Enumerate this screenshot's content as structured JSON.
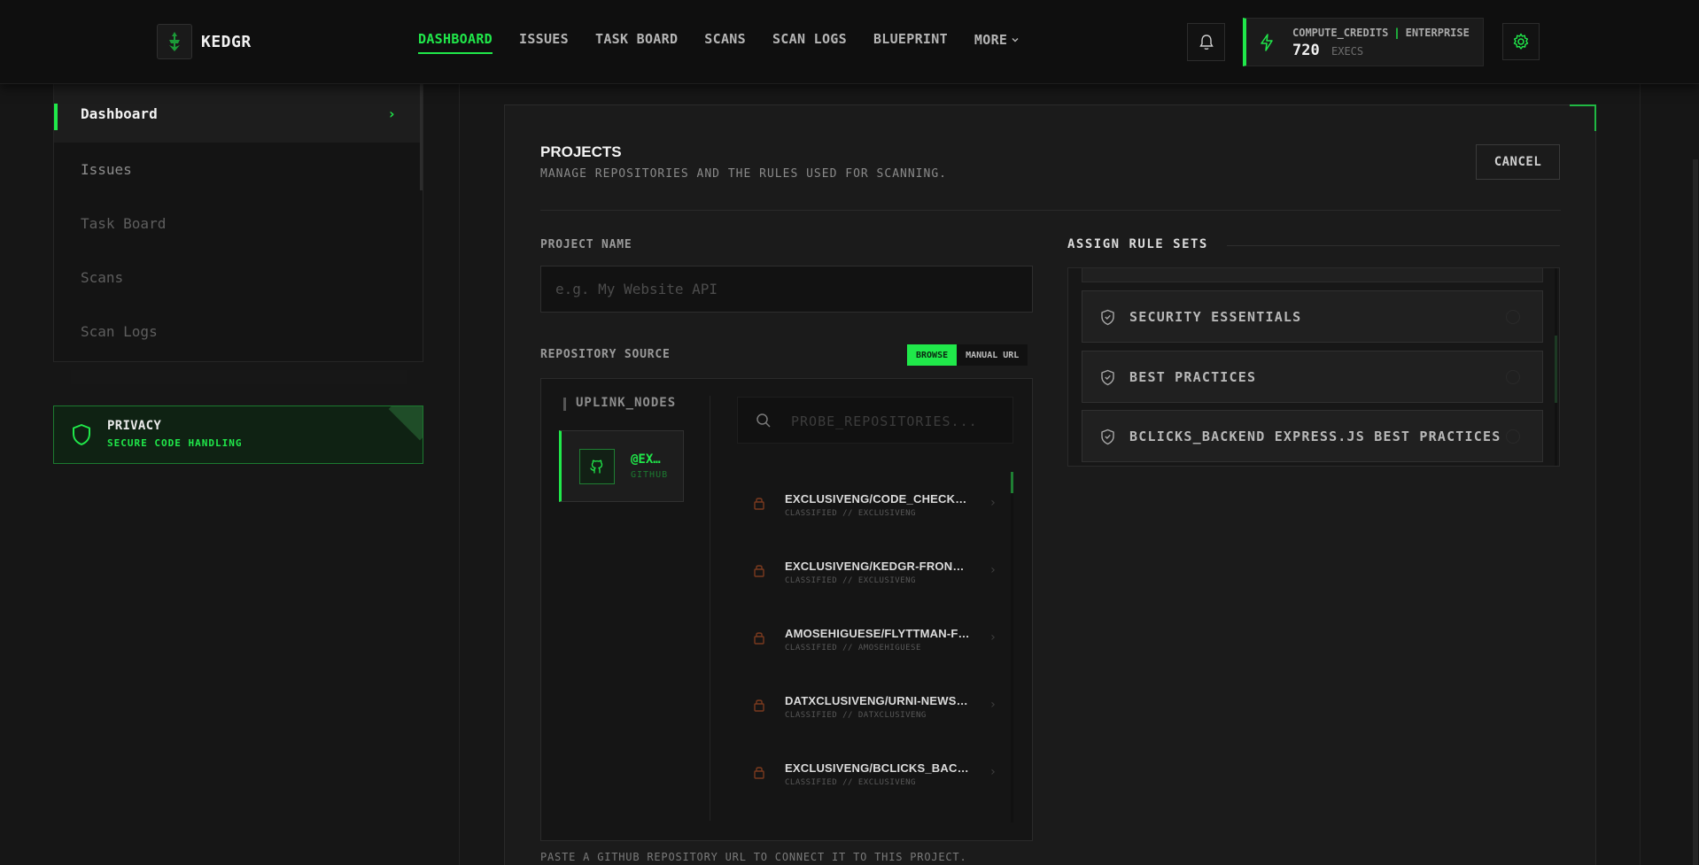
{
  "app": {
    "name": "KEDGR"
  },
  "nav": {
    "items": [
      "DASHBOARD",
      "ISSUES",
      "TASK BOARD",
      "SCANS",
      "SCAN LOGS",
      "BLUEPRINT"
    ],
    "more": "MORE",
    "active": "DASHBOARD"
  },
  "credits": {
    "label": "COMPUTE_CREDITS",
    "tier": "ENTERPRISE",
    "value": "720",
    "unit": "EXECS"
  },
  "sidebar": {
    "items": [
      {
        "label": "Dashboard"
      },
      {
        "label": "Issues"
      },
      {
        "label": "Task Board"
      },
      {
        "label": "Scans"
      },
      {
        "label": "Scan Logs"
      }
    ]
  },
  "privacy": {
    "title": "PRIVACY",
    "subtitle": "SECURE CODE HANDLING"
  },
  "projects": {
    "title": "PROJECTS",
    "subtitle": "MANAGE REPOSITORIES AND THE RULES USED FOR SCANNING.",
    "cancel": "CANCEL",
    "name_label": "PROJECT NAME",
    "name_placeholder": "e.g. My Website API",
    "repo_source_label": "REPOSITORY SOURCE",
    "toggle": {
      "browse": "BROWSE",
      "manual": "MANUAL URL",
      "selected": "BROWSE"
    },
    "uplink_title": "UPLINK_NODES",
    "node": {
      "name": "@EX…",
      "provider": "GITHUB"
    },
    "search_placeholder": "PROBE_REPOSITORIES...",
    "repos": [
      {
        "name": "EXCLUSIVENG/CODE_CHECKER",
        "meta": "CLASSIFIED // EXCLUSIVENG"
      },
      {
        "name": "EXCLUSIVENG/KEDGR-FRONTE…",
        "meta": "CLASSIFIED // EXCLUSIVENG"
      },
      {
        "name": "AMOSEHIGUESE/FLYTTMAN-FR…",
        "meta": "CLASSIFIED // AMOSEHIGUESE"
      },
      {
        "name": "DATXCLUSIVENG/URNI-NEWSL…",
        "meta": "CLASSIFIED // DATXCLUSIVENG"
      },
      {
        "name": "EXCLUSIVENG/BCLICKS_BACK…",
        "meta": "CLASSIFIED // EXCLUSIVENG"
      }
    ],
    "footer_note": "PASTE A GITHUB REPOSITORY URL TO CONNECT IT TO THIS PROJECT.",
    "rule_sets_title": "ASSIGN RULE SETS",
    "rule_sets": [
      {
        "label": "SECURITY ESSENTIALS"
      },
      {
        "label": "BEST PRACTICES"
      },
      {
        "label": "BCLICKS_BACKEND EXPRESS.JS BEST PRACTICES"
      }
    ]
  },
  "colors": {
    "accent": "#20e84a",
    "background": "#161616",
    "lock": "#7a3a1e"
  }
}
